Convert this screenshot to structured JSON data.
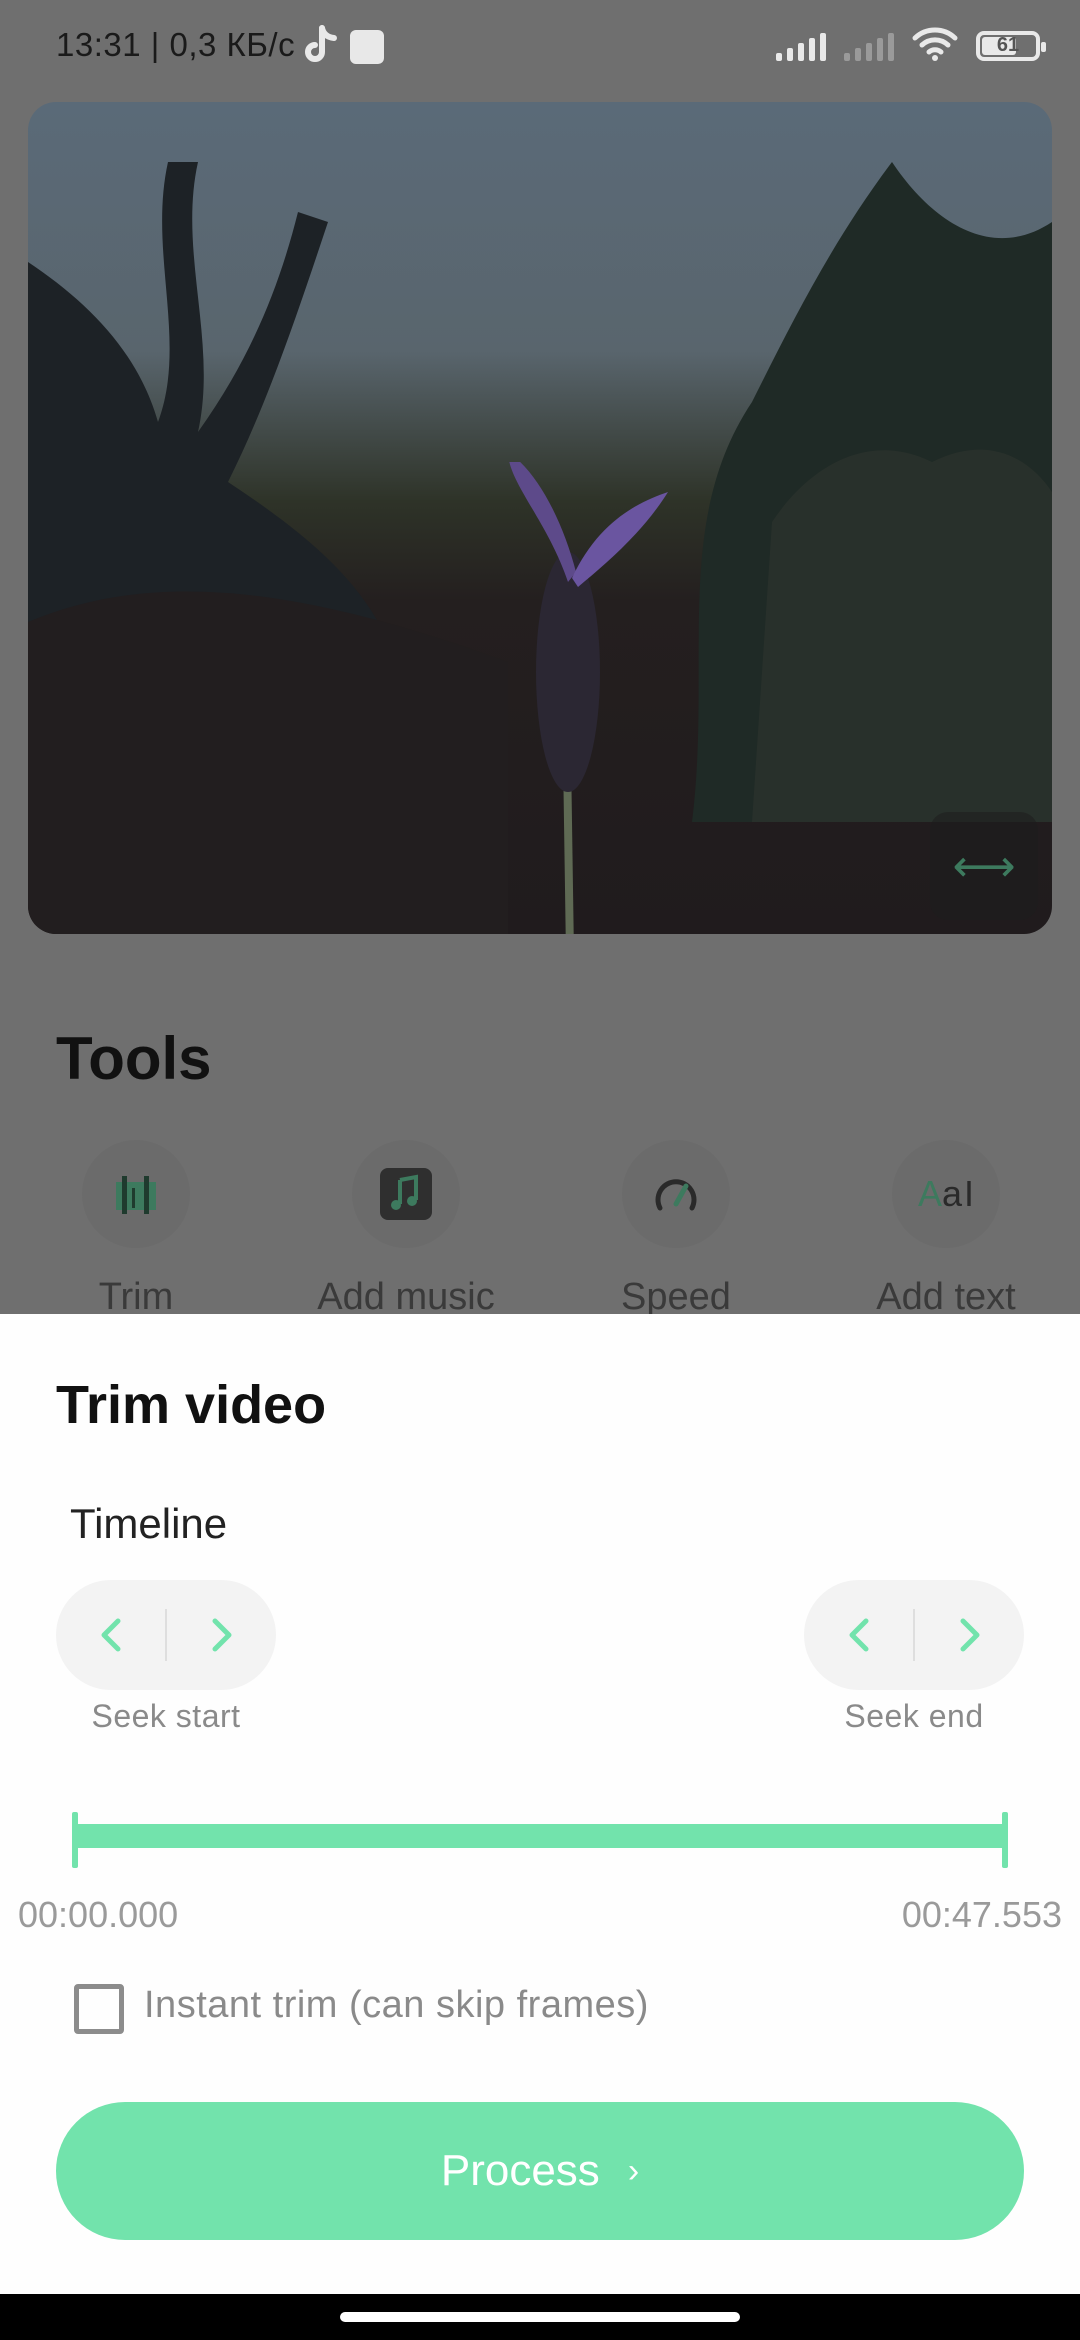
{
  "status_bar": {
    "time_and_speed": "13:31 | 0,3 КБ/с",
    "battery_level": "61"
  },
  "video_preview": {
    "expand_icon": "horizontal-expand-icon"
  },
  "tools": {
    "title": "Tools",
    "items": [
      {
        "label": "Trim",
        "icon": "trim-icon"
      },
      {
        "label": "Add music",
        "icon": "music-note-icon"
      },
      {
        "label": "Speed",
        "icon": "speed-gauge-icon"
      },
      {
        "label": "Add text",
        "icon": "text-icon"
      }
    ]
  },
  "trim_sheet": {
    "title": "Trim video",
    "timeline_label": "Timeline",
    "seek_start_caption": "Seek start",
    "seek_end_caption": "Seek end",
    "range_start": "00:00.000",
    "range_end": "00:47.553",
    "instant_trim_label": "Instant trim (can skip frames)",
    "instant_trim_checked": false,
    "process_label": "Process",
    "accent_color": "#72e3ac"
  }
}
